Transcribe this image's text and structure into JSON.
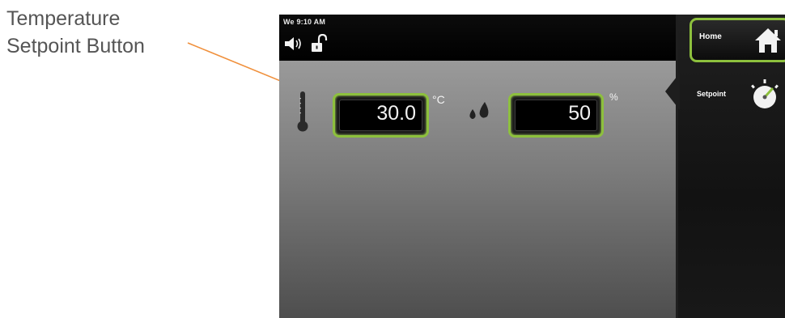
{
  "callout": {
    "line1": "Temperature",
    "line2": "Setpoint Button",
    "arrow_color": "#f0903c"
  },
  "status_bar": {
    "datetime": "We 9:10 AM",
    "speaker_icon": "speaker-icon",
    "lock_icon": "unlocked-padlock-icon"
  },
  "temperature": {
    "value": "30.0",
    "unit": "°C",
    "icon": "thermometer-icon"
  },
  "humidity": {
    "value": "50",
    "unit": "%",
    "icon": "water-drops-icon"
  },
  "sidebar": {
    "home_label": "Home",
    "home_icon": "home-icon",
    "setpoint_label": "Setpoint",
    "setpoint_icon": "gauge-dial-icon"
  },
  "colors": {
    "accent_green": "#8dc03d",
    "screen_black": "#000000"
  }
}
